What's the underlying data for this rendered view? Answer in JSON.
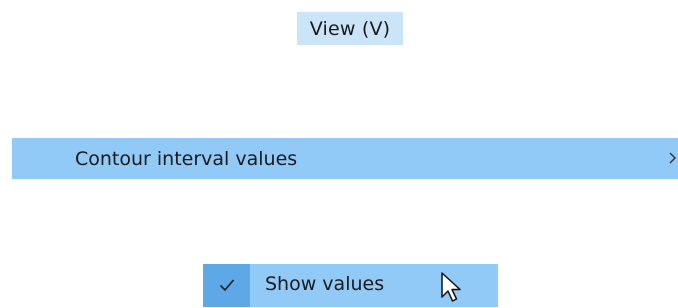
{
  "menu": {
    "view_label": "View (V)"
  },
  "submenu": {
    "item_label": "Contour interval values",
    "arrow_icon": "chevron-right-icon"
  },
  "subitem": {
    "label": "Show values",
    "checked": true,
    "check_icon": "checkmark-icon"
  },
  "cursor": {
    "icon": "mouse-pointer-icon"
  },
  "colors": {
    "menu_highlight": "#cce4f7",
    "item_highlight": "#91c9f7",
    "check_background": "#5fa8e8"
  }
}
